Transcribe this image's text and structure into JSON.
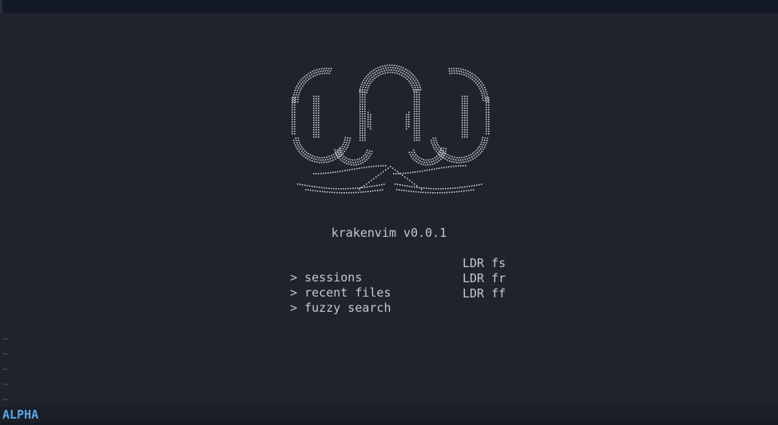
{
  "window": {
    "top_bar_color": "#131924",
    "background": "#1f232e"
  },
  "dashboard": {
    "title": "krakenvim v0.0.1",
    "buttons": [
      {
        "arrow": ">",
        "label": "sessions",
        "shortcut": "LDR fs"
      },
      {
        "arrow": ">",
        "label": "recent files",
        "shortcut": "LDR fr"
      },
      {
        "arrow": ">",
        "label": "fuzzy search",
        "shortcut": "LDR ff"
      }
    ]
  },
  "empty_lines": [
    "~",
    "~",
    "~",
    "~",
    "~"
  ],
  "statusline": {
    "mode": "ALPHA",
    "mode_color": "#5aa7e6"
  },
  "logo": {
    "name": "kraken-ascii-logo",
    "color": "#c9cdd6"
  }
}
